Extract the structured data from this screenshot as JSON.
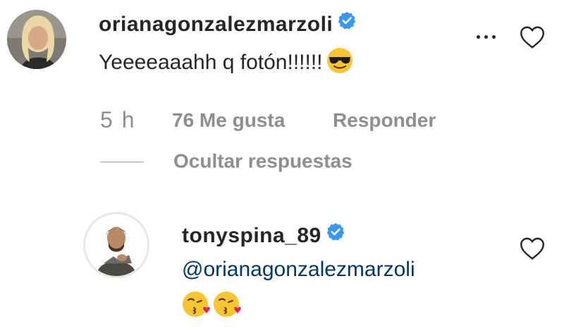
{
  "comment": {
    "username": "orianagonzalezmarzoli",
    "verified_icon": "verified-badge-icon",
    "text": "Yeeeeaaahh q fotón!!!!!!",
    "emoji": "😎",
    "time": "5 h",
    "likes": "76 Me gusta",
    "reply_label": "Responder",
    "hide_replies_label": "Ocultar respuestas"
  },
  "reply": {
    "username": "tonyspina_89",
    "verified_icon": "verified-badge-icon",
    "mention": "@orianagonzalezmarzoli",
    "emojis": "😘😘"
  },
  "colors": {
    "verified_blue": "#3897f0",
    "mention_blue": "#00376b",
    "meta_gray": "#8e8e8e",
    "text": "#262626"
  }
}
